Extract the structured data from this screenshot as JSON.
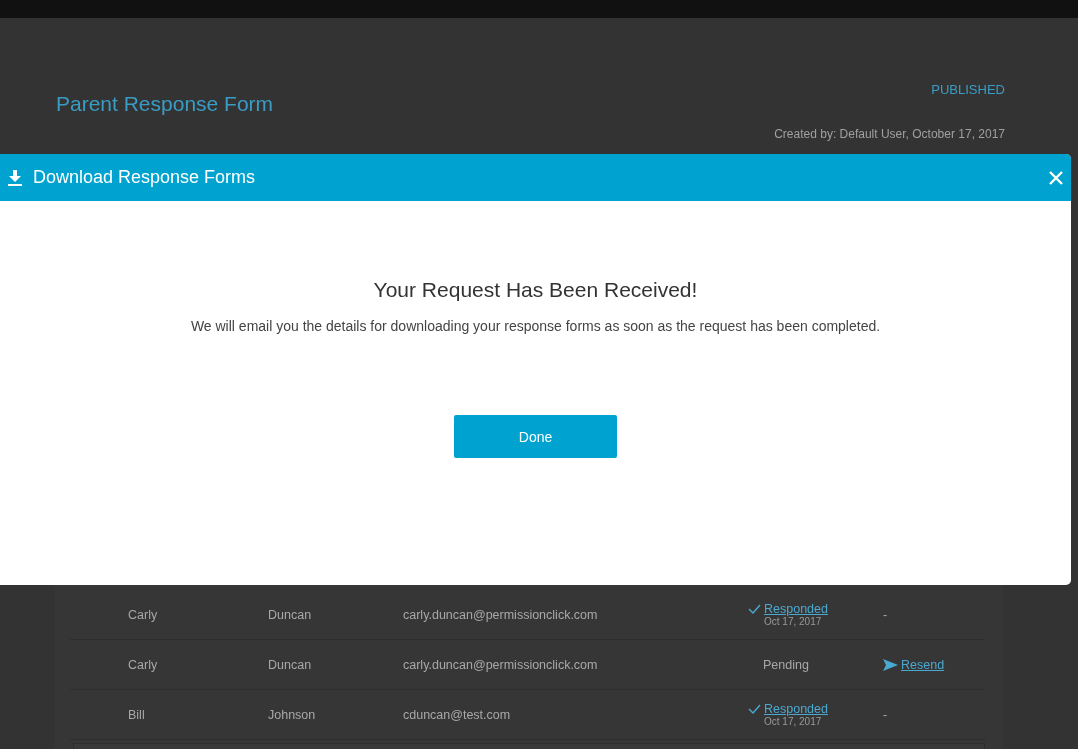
{
  "page": {
    "title": "Parent Response Form",
    "status": "PUBLISHED",
    "created": "Created by: Default User, October 17, 2017"
  },
  "rows": [
    {
      "first": "Carly",
      "last": "Duncan",
      "email": "carly.duncan@permissionclick.com",
      "status": {
        "kind": "responded",
        "label": "Responded",
        "date": "Oct 17, 2017"
      },
      "action": {
        "kind": "none",
        "label": "-"
      }
    },
    {
      "first": "Carly",
      "last": "Duncan",
      "email": "carly.duncan@permissionclick.com",
      "status": {
        "kind": "pending",
        "label": "Pending"
      },
      "action": {
        "kind": "resend",
        "label": "Resend"
      }
    },
    {
      "first": "Bill",
      "last": "Johnson",
      "email": "cduncan@test.com",
      "status": {
        "kind": "responded",
        "label": "Responded",
        "date": "Oct 17, 2017"
      },
      "action": {
        "kind": "none",
        "label": "-"
      }
    }
  ],
  "modal": {
    "title": "Download Response Forms",
    "heading": "Your Request Has Been Received!",
    "message": "We will email you the details for downloading your response forms as soon as the request has been completed.",
    "button": "Done"
  }
}
